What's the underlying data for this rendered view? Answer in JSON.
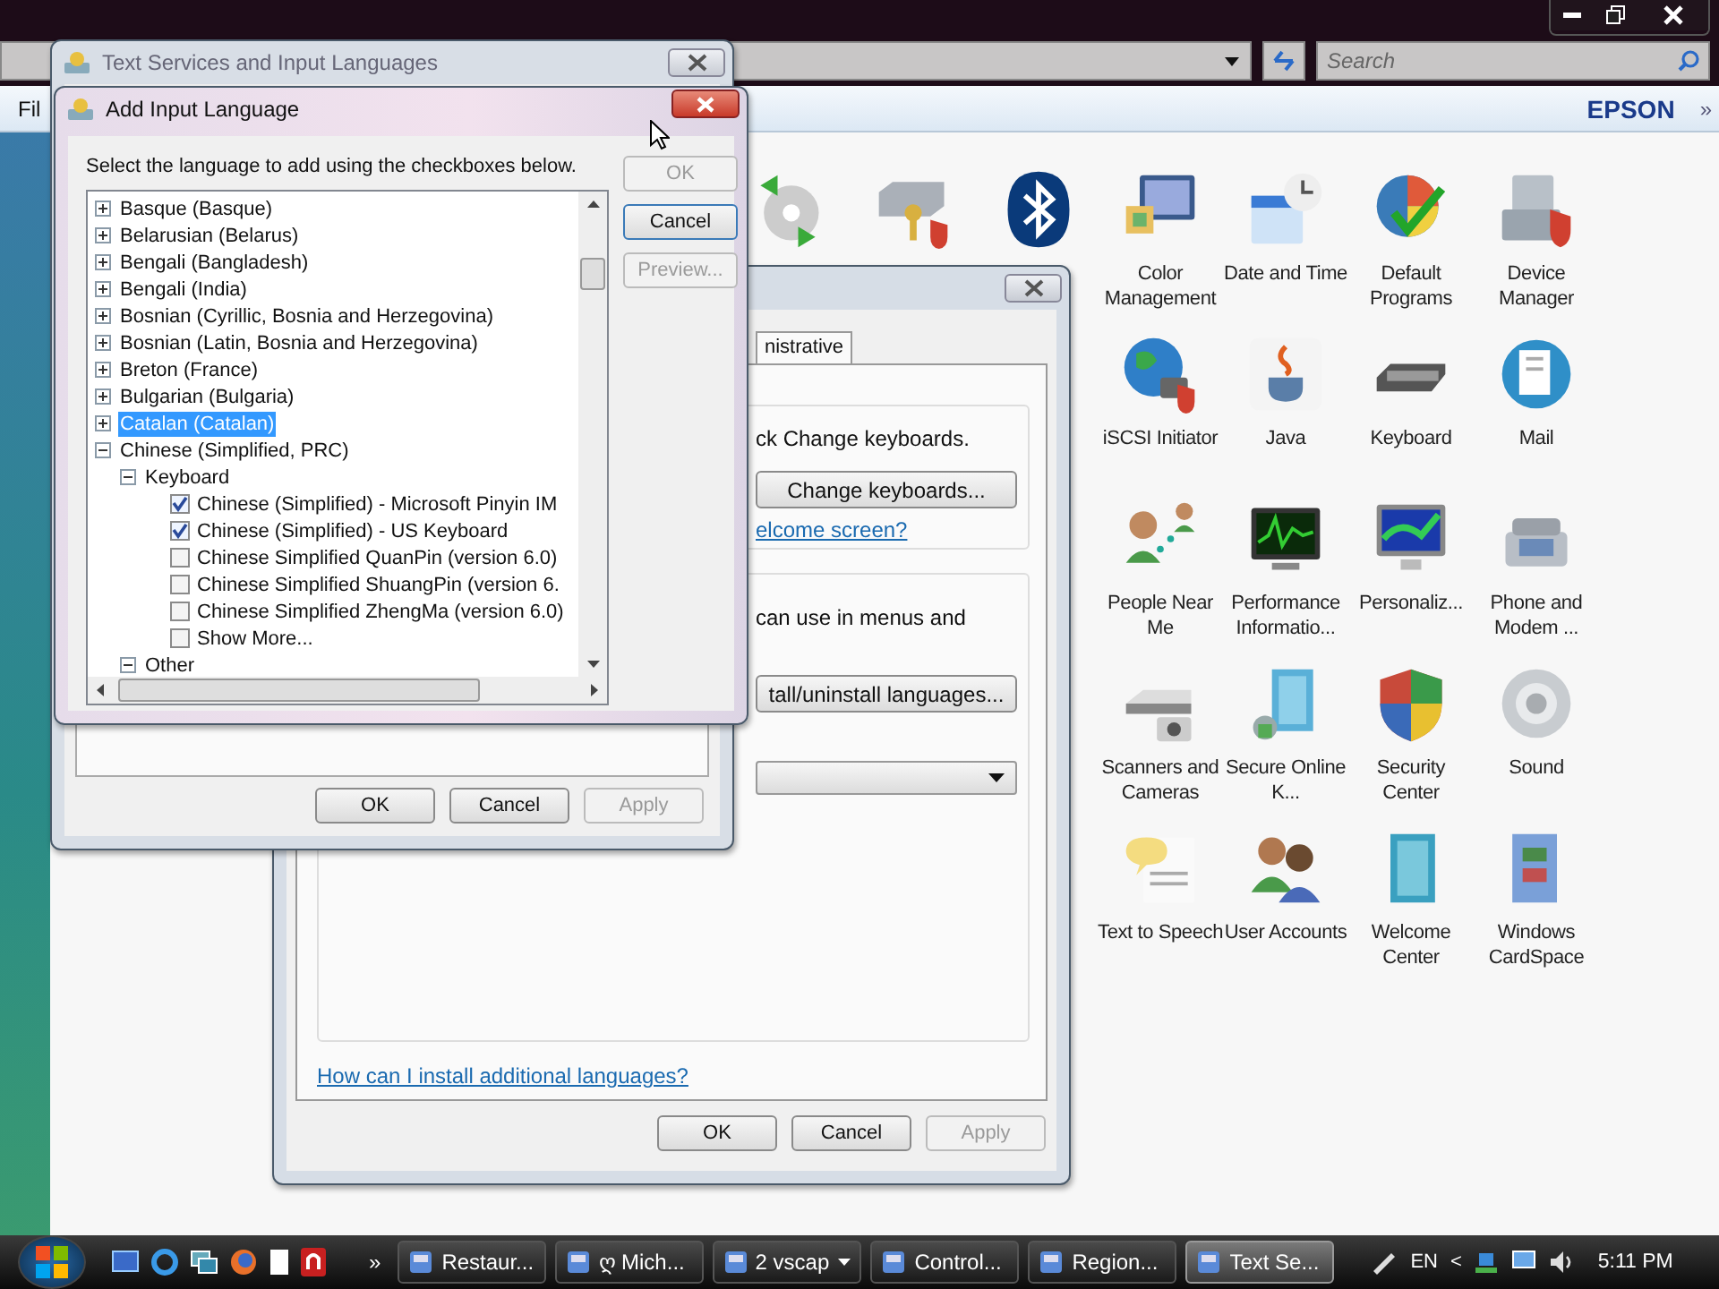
{
  "explorer": {
    "menu": [
      {
        "label": "Fil"
      }
    ],
    "search": {
      "placeholder": "Search"
    },
    "toolbar_brand": "EPSON",
    "toolbar_overflow": "»",
    "items": [
      {
        "label": "Color Management"
      },
      {
        "label": "Date and Time"
      },
      {
        "label": "Default Programs"
      },
      {
        "label": "Device Manager"
      },
      {
        "label": "iSCSI Initiator"
      },
      {
        "label": "Java"
      },
      {
        "label": "Keyboard"
      },
      {
        "label": "Mail"
      },
      {
        "label": "People Near Me"
      },
      {
        "label": "Performance Informatio..."
      },
      {
        "label": "Personaliz..."
      },
      {
        "label": "Phone and Modem ..."
      },
      {
        "label": "Scanners and Cameras"
      },
      {
        "label": "Secure Online K..."
      },
      {
        "label": "Security Center"
      },
      {
        "label": "Sound"
      },
      {
        "label": "Text to Speech"
      },
      {
        "label": "User Accounts"
      },
      {
        "label": "Welcome Center"
      },
      {
        "label": "Windows CardSpace"
      }
    ]
  },
  "regional_dialog": {
    "tab": {
      "label": "nistrative",
      "selected": true
    },
    "keyboards_text": "ck Change keyboards.",
    "change_keyboards_button": "Change keyboards...",
    "welcome_link": "elcome screen?",
    "languages_text": "can use in menus and",
    "install_button": "tall/uninstall languages...",
    "help_link": "How can I install additional languages?",
    "buttons": [
      {
        "label": "OK",
        "disabled": false
      },
      {
        "label": "Cancel",
        "disabled": false
      },
      {
        "label": "Apply",
        "disabled": true
      }
    ]
  },
  "text_services_dialog": {
    "title": "Text Services and Input Languages",
    "buttons": [
      {
        "label": "OK",
        "disabled": false
      },
      {
        "label": "Cancel",
        "disabled": false
      },
      {
        "label": "Apply",
        "disabled": true
      }
    ]
  },
  "add_language_dialog": {
    "title": "Add Input Language",
    "instruction": "Select the language to add using the checkboxes below.",
    "buttons": [
      {
        "label": "OK",
        "disabled": true
      },
      {
        "label": "Cancel",
        "disabled": false
      },
      {
        "label": "Preview...",
        "disabled": true
      }
    ],
    "tree": [
      {
        "kind": "node",
        "label": "Basque (Basque)",
        "expanded": false,
        "selected": false
      },
      {
        "kind": "node",
        "label": "Belarusian (Belarus)",
        "expanded": false,
        "selected": false
      },
      {
        "kind": "node",
        "label": "Bengali (Bangladesh)",
        "expanded": false,
        "selected": false
      },
      {
        "kind": "node",
        "label": "Bengali (India)",
        "expanded": false,
        "selected": false
      },
      {
        "kind": "node",
        "label": "Bosnian (Cyrillic, Bosnia and Herzegovina)",
        "expanded": false,
        "selected": false
      },
      {
        "kind": "node",
        "label": "Bosnian (Latin, Bosnia and Herzegovina)",
        "expanded": false,
        "selected": false
      },
      {
        "kind": "node",
        "label": "Breton (France)",
        "expanded": false,
        "selected": false
      },
      {
        "kind": "node",
        "label": "Bulgarian (Bulgaria)",
        "expanded": false,
        "selected": false
      },
      {
        "kind": "node",
        "label": "Catalan (Catalan)",
        "expanded": false,
        "selected": true
      },
      {
        "kind": "node",
        "label": "Chinese (Simplified, PRC)",
        "expanded": true,
        "selected": false,
        "children": [
          {
            "kind": "node",
            "label": "Keyboard",
            "expanded": true,
            "selected": false,
            "children": [
              {
                "kind": "checkbox",
                "label": "Chinese (Simplified) - Microsoft Pinyin IM",
                "checked": true
              },
              {
                "kind": "checkbox",
                "label": "Chinese (Simplified) - US Keyboard",
                "checked": true
              },
              {
                "kind": "checkbox",
                "label": "Chinese Simplified QuanPin (version 6.0)",
                "checked": false
              },
              {
                "kind": "checkbox",
                "label": "Chinese Simplified ShuangPin (version 6.",
                "checked": false
              },
              {
                "kind": "checkbox",
                "label": "Chinese Simplified ZhengMa (version 6.0)",
                "checked": false
              },
              {
                "kind": "checkbox",
                "label": "Show More...",
                "checked": false
              }
            ]
          },
          {
            "kind": "node",
            "label": "Other",
            "expanded": true,
            "selected": false
          }
        ]
      }
    ]
  },
  "taskbar": {
    "overflow": "»",
    "tasks": [
      {
        "label": "Restaur...",
        "kind": "window",
        "selected": false
      },
      {
        "label": "ღ Mich...",
        "kind": "window",
        "selected": false
      },
      {
        "label": "2 vscap",
        "kind": "group",
        "selected": false
      },
      {
        "label": "Control...",
        "kind": "window",
        "selected": false
      },
      {
        "label": "Region...",
        "kind": "window",
        "selected": false
      },
      {
        "label": "Text Se...",
        "kind": "window",
        "selected": true
      }
    ],
    "language": "EN",
    "tray_expand": "<",
    "clock": "5:11 PM"
  }
}
